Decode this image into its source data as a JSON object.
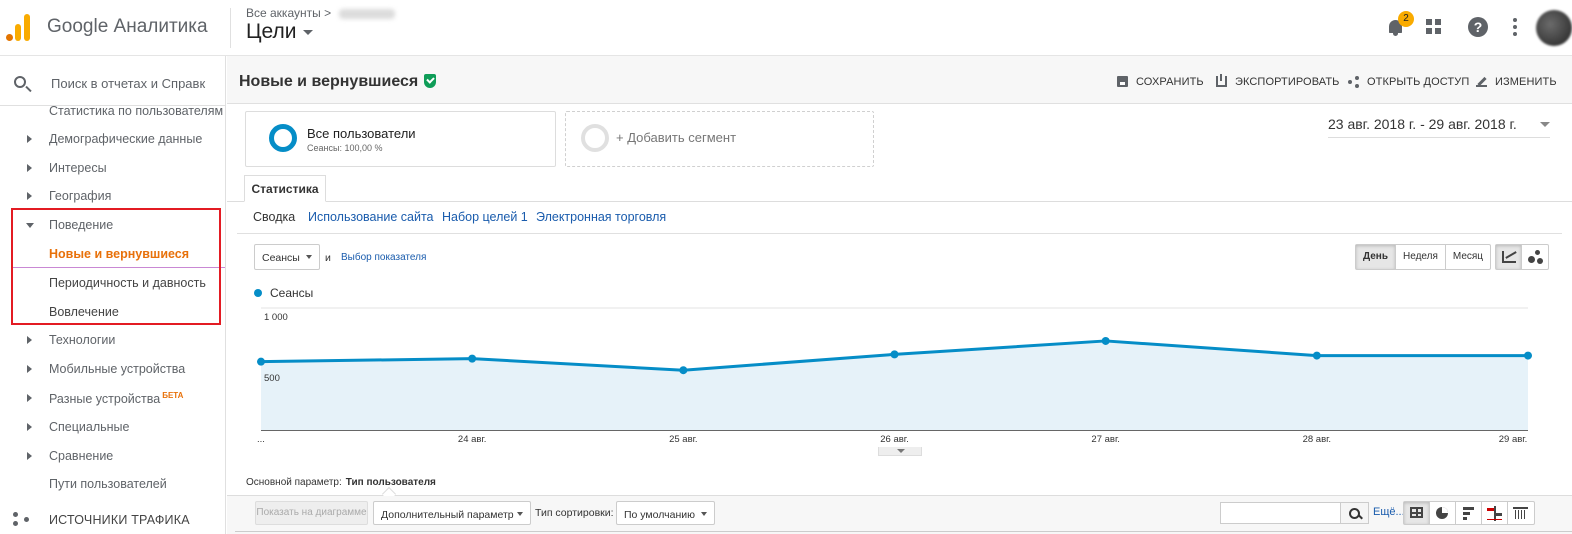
{
  "app": {
    "brand": "Google Аналитика",
    "accounts_label": "Все аккаунты",
    "view_title": "Цели",
    "notifications_count": "2",
    "icons": [
      "analytics-logo-icon",
      "bell-icon",
      "apps-grid-icon",
      "help-icon",
      "more-vert-icon",
      "avatar"
    ]
  },
  "sidebar": {
    "search_placeholder": "Поиск в отчетах и Справк",
    "items": [
      {
        "label": "Статистика по пользователям",
        "kind": "clipped"
      },
      {
        "label": "Демографические данные",
        "kind": "collapsed"
      },
      {
        "label": "Интересы",
        "kind": "collapsed"
      },
      {
        "label": "География",
        "kind": "collapsed"
      },
      {
        "label": "Поведение",
        "kind": "expanded"
      },
      {
        "label": "Новые и вернувшиеся",
        "kind": "sub-active"
      },
      {
        "label": "Периодичность и давность",
        "kind": "sub"
      },
      {
        "label": "Вовлечение",
        "kind": "sub"
      },
      {
        "label": "Технологии",
        "kind": "collapsed"
      },
      {
        "label": "Мобильные устройства",
        "kind": "collapsed"
      },
      {
        "label": "Разные устройства",
        "kind": "collapsed",
        "badge": "БЕТА"
      },
      {
        "label": "Специальные",
        "kind": "collapsed"
      },
      {
        "label": "Сравнение",
        "kind": "collapsed"
      },
      {
        "label": "Пути пользователей",
        "kind": "plain"
      }
    ],
    "section": "ИСТОЧНИКИ ТРАФИКА",
    "highlight_color": "#e31b23",
    "active_color": "#e8710a"
  },
  "report": {
    "title": "Новые и вернувшиеся",
    "actions": {
      "save": "СОХРАНИТЬ",
      "export": "ЭКСПОРТИРОВАТЬ",
      "share": "ОТКРЫТЬ ДОСТУП",
      "edit": "ИЗМЕНИТЬ"
    },
    "segment": {
      "name": "Все пользователи",
      "sub": "Сеансы: 100,00 %"
    },
    "add_segment": "+ Добавить сегмент",
    "date_range": "23 авг. 2018 г. - 29 авг. 2018 г.",
    "tab": "Статистика",
    "subnav": [
      "Сводка",
      "Использование сайта",
      "Набор целей 1",
      "Электронная торговля"
    ],
    "metric_select": "Сеансы",
    "and_label": "и",
    "pick_metric": "Выбор показателя",
    "granularity": [
      "День",
      "Неделя",
      "Месяц"
    ],
    "granularity_selected": "День",
    "chart_types": [
      "line-chart-icon",
      "motion-chart-icon"
    ]
  },
  "chart_data": {
    "type": "area",
    "series": [
      {
        "name": "Сеансы",
        "values": [
          560,
          585,
          490,
          620,
          730,
          610,
          610
        ],
        "color": "#058dc7"
      }
    ],
    "x": [
      "23 авг.",
      "24 авг.",
      "25 авг.",
      "26 авг.",
      "27 авг.",
      "28 авг.",
      "29 авг."
    ],
    "x_tick_labels": [
      "...",
      "24 авг.",
      "25 авг.",
      "26 авг.",
      "27 авг.",
      "28 авг.",
      "29 авг."
    ],
    "y_ticks": [
      {
        "value": 1000,
        "label": "1 000"
      },
      {
        "value": 500,
        "label": "500"
      }
    ],
    "ylim": [
      0,
      1000
    ],
    "legend": "top-left",
    "grid": true
  },
  "table_controls": {
    "primary_label": "Основной параметр:",
    "primary_value": "Тип пользователя",
    "plot_rows": "Показать на диаграмме",
    "secondary_dim": "Дополнительный параметр",
    "sort_label": "Тип сортировки:",
    "sort_value": "По умолчанию",
    "more": "Ещё...",
    "view_icons": [
      "table-view-icon",
      "pie-view-icon",
      "performance-view-icon",
      "comparison-view-icon",
      "pivot-view-icon"
    ]
  }
}
